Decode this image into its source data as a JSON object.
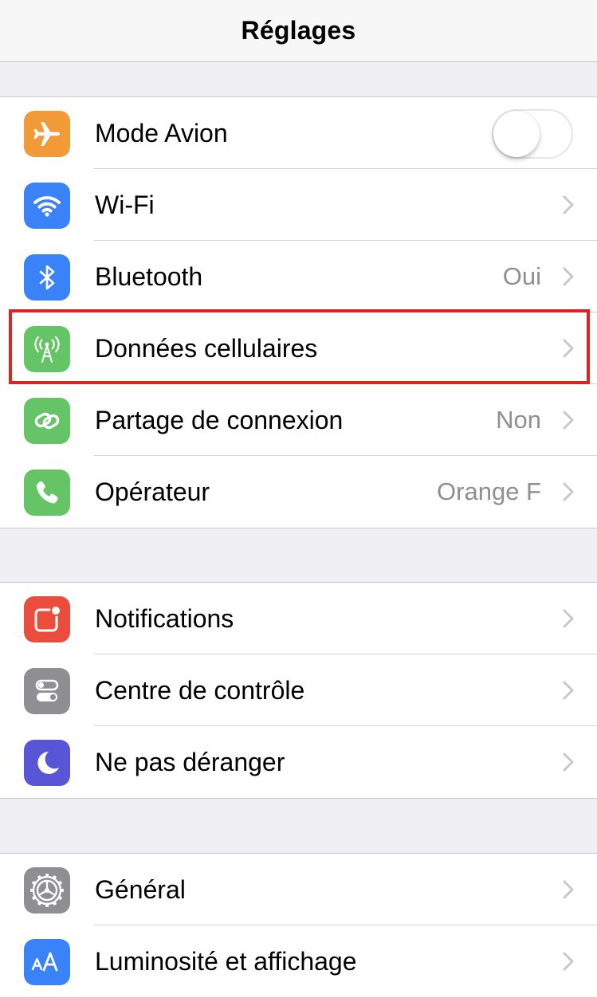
{
  "navbar": {
    "title": "Réglages"
  },
  "colors": {
    "airplane": "#f19a37",
    "wifi": "#3a82f7",
    "bluetooth": "#3a82f7",
    "cellular": "#65c466",
    "hotspot": "#65c466",
    "carrier": "#65c466",
    "notifications": "#eb4d3d",
    "control_center": "#8e8e93",
    "do_not_disturb": "#5856d6",
    "general": "#8e8e93",
    "display": "#3a82f7",
    "highlight": "#e0231e"
  },
  "groups": [
    {
      "rows": [
        {
          "label": "Mode Avion",
          "icon": "airplane-icon",
          "toggle": false
        },
        {
          "label": "Wi-Fi",
          "icon": "wifi-icon",
          "value": ""
        },
        {
          "label": "Bluetooth",
          "icon": "bluetooth-icon",
          "value": "Oui"
        },
        {
          "label": "Données cellulaires",
          "icon": "cellular-antenna-icon",
          "value": "",
          "highlighted": true
        },
        {
          "label": "Partage de connexion",
          "icon": "hotspot-chain-icon",
          "value": "Non"
        },
        {
          "label": "Opérateur",
          "icon": "phone-icon",
          "value": "Orange F"
        }
      ]
    },
    {
      "rows": [
        {
          "label": "Notifications",
          "icon": "notifications-icon"
        },
        {
          "label": "Centre de contrôle",
          "icon": "control-center-icon"
        },
        {
          "label": "Ne pas déranger",
          "icon": "moon-icon"
        }
      ]
    },
    {
      "rows": [
        {
          "label": "Général",
          "icon": "gear-icon"
        },
        {
          "label": "Luminosité et affichage",
          "icon": "text-size-icon"
        }
      ]
    }
  ]
}
